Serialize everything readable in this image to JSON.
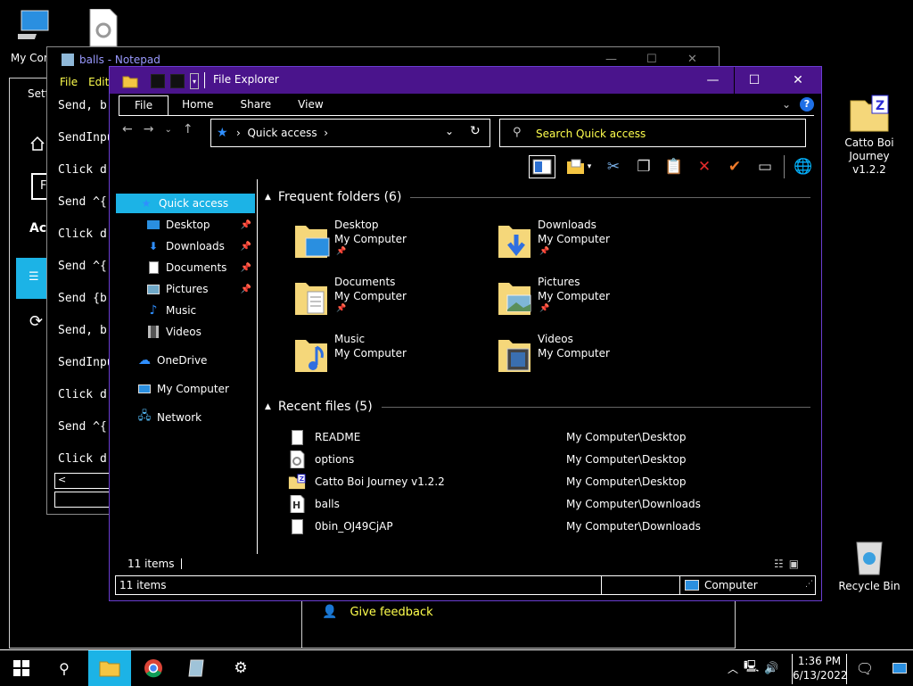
{
  "desktop": {
    "icons": [
      {
        "label": "My Comp"
      },
      {
        "label": ""
      },
      {
        "label": "Catto Boi\nJourney v1.2.2"
      },
      {
        "label": "Recycle Bin"
      }
    ]
  },
  "settings": {
    "title": "Setti",
    "box_letter": "F",
    "accounts_label": "Acc",
    "feedback": "Give feedback"
  },
  "notepad": {
    "title": "balls - Notepad",
    "menu": [
      "File",
      "Edit"
    ],
    "lines": [
      "Send, b",
      "SendInpu",
      "Click d",
      "Send ^{",
      "Click d",
      "Send ^{",
      "Send {b",
      "Send, b",
      "SendInpu",
      "Click d",
      "Send ^{",
      "Click d"
    ]
  },
  "explorer": {
    "title": "File Explorer",
    "ribbon_tabs": [
      "File",
      "Home",
      "Share",
      "View"
    ],
    "address": "Quick access",
    "search_placeholder": "Search Quick access",
    "nav": [
      {
        "label": "Quick access",
        "icon": "star-icon",
        "selected": true
      },
      {
        "label": "Desktop",
        "icon": "desktop-icon",
        "pinned": true
      },
      {
        "label": "Downloads",
        "icon": "download-icon",
        "pinned": true
      },
      {
        "label": "Documents",
        "icon": "document-icon",
        "pinned": true
      },
      {
        "label": "Pictures",
        "icon": "picture-icon",
        "pinned": true
      },
      {
        "label": "Music",
        "icon": "music-icon"
      },
      {
        "label": "Videos",
        "icon": "video-icon"
      },
      {
        "label": "OneDrive",
        "icon": "cloud-icon"
      },
      {
        "label": "My Computer",
        "icon": "computer-icon"
      },
      {
        "label": "Network",
        "icon": "network-icon"
      }
    ],
    "frequent_header": "Frequent folders (6)",
    "frequent": [
      {
        "name": "Desktop",
        "location": "My Computer",
        "pinned": true
      },
      {
        "name": "Downloads",
        "location": "My Computer",
        "pinned": true
      },
      {
        "name": "Documents",
        "location": "My Computer",
        "pinned": true
      },
      {
        "name": "Pictures",
        "location": "My Computer",
        "pinned": true
      },
      {
        "name": "Music",
        "location": "My Computer"
      },
      {
        "name": "Videos",
        "location": "My Computer"
      }
    ],
    "recent_header": "Recent files (5)",
    "recent": [
      {
        "name": "README",
        "location": "My Computer\\Desktop",
        "icon": "text-file-icon"
      },
      {
        "name": "options",
        "location": "My Computer\\Desktop",
        "icon": "settings-file-icon"
      },
      {
        "name": "Catto Boi Journey v1.2.2",
        "location": "My Computer\\Desktop",
        "icon": "zip-folder-icon"
      },
      {
        "name": "balls",
        "location": "My Computer\\Downloads",
        "icon": "autohotkey-file-icon"
      },
      {
        "name": "0bin_OJ49CjAP",
        "location": "My Computer\\Downloads",
        "icon": "text-file-icon"
      }
    ],
    "status_items": "11 items",
    "bottom_items": "11 items",
    "bottom_computer": "Computer"
  },
  "taskbar": {
    "time": "1:36 PM",
    "date": "6/13/2022"
  }
}
